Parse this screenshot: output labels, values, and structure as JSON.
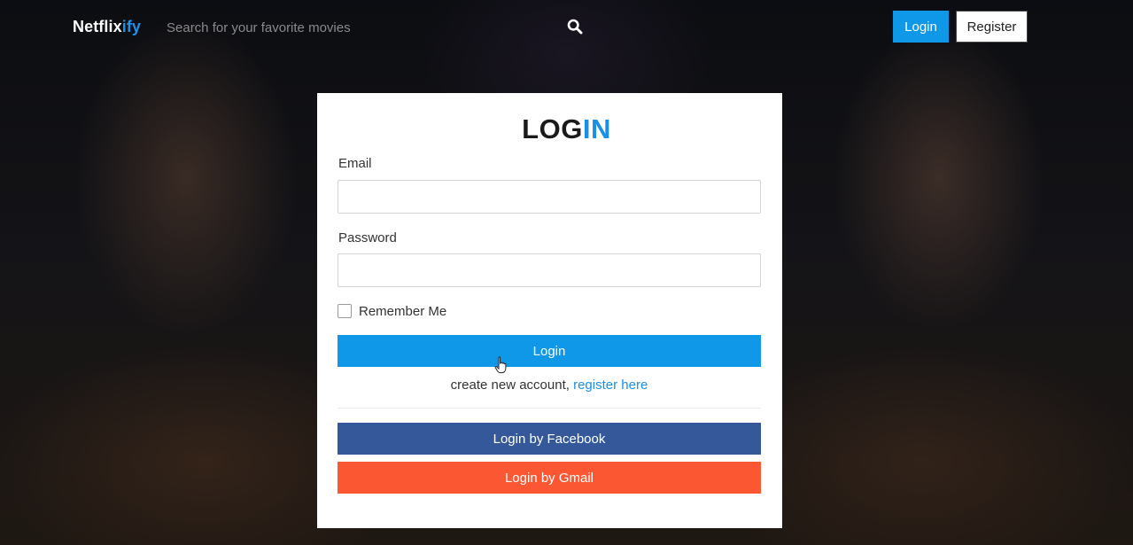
{
  "navbar": {
    "brand_main": "Netflix",
    "brand_accent": "ify",
    "search_placeholder": "Search for your favorite movies",
    "search_icon": "search-icon",
    "login_label": "Login",
    "register_label": "Register"
  },
  "login_form": {
    "title_dark": "LOG",
    "title_blue": "IN",
    "email_label": "Email",
    "email_value": "",
    "password_label": "Password",
    "password_value": "",
    "remember_label": "Remember Me",
    "remember_checked": false,
    "submit_label": "Login",
    "register_prompt": "create new account, ",
    "register_link": "register here",
    "facebook_label": "Login by Facebook",
    "gmail_label": "Login by Gmail"
  },
  "colors": {
    "accent_blue": "#0f97e8",
    "facebook_blue": "#35589a",
    "gmail_orange": "#fb5733"
  }
}
